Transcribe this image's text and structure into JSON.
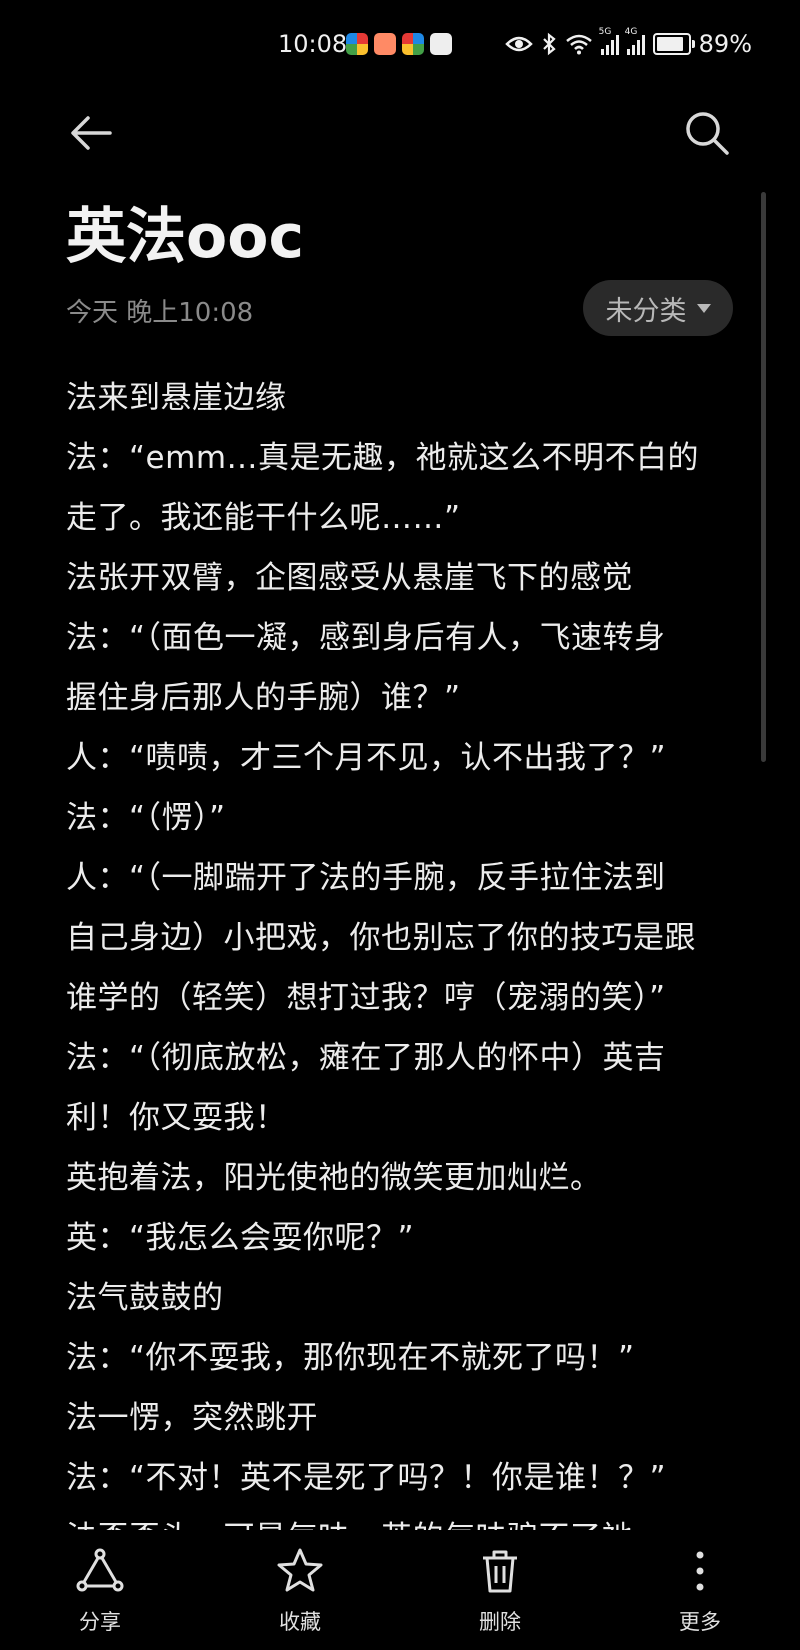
{
  "status_bar": {
    "time": "10:08",
    "battery_percent_label": "89%",
    "battery_level": 0.89,
    "network_1": "5G",
    "network_2": "4G",
    "icons": [
      "app-notification-icon",
      "app-notification-icon",
      "app-notification-icon",
      "app-notification-icon",
      "eye-icon",
      "bluetooth-icon",
      "wifi-icon",
      "signal-icon",
      "signal-icon",
      "battery-icon"
    ]
  },
  "header": {
    "back_icon": "arrow-left-icon",
    "search_icon": "search-icon"
  },
  "note": {
    "title": "英法ooc",
    "date": "今天 晚上10:08",
    "category": "未分类",
    "lines": [
      "法来到悬崖边缘",
      "法：“emm…真是无趣，祂就这么不明不白的",
      "走了。我还能干什么呢……”",
      "法张开双臂，企图感受从悬崖飞下的感觉",
      "法：“（面色一凝，感到身后有人，飞速转身",
      "握住身后那人的手腕）谁？”",
      "人：“啧啧，才三个月不见，认不出我了？”",
      "法：“（愣）”",
      "人：“（一脚踹开了法的手腕，反手拉住法到",
      "自己身边）小把戏，你也别忘了你的技巧是跟",
      "谁学的（轻笑）想打过我？哼（宠溺的笑）”",
      "法：“（彻底放松，瘫在了那人的怀中）英吉",
      "利！你又耍我！",
      "英抱着法，阳光使祂的微笑更加灿烂。",
      "英：“我怎么会耍你呢？”",
      "法气鼓鼓的",
      "法：“你不耍我，那你现在不就死了吗！”",
      "法一愣，突然跳开",
      "法：“不对！英不是死了吗？！你是谁！？”",
      "法歪歪头，可是气味，英的气味骗不了祂"
    ]
  },
  "bottom_bar": {
    "share": "分享",
    "favorite": "收藏",
    "delete": "删除",
    "more": "更多"
  }
}
